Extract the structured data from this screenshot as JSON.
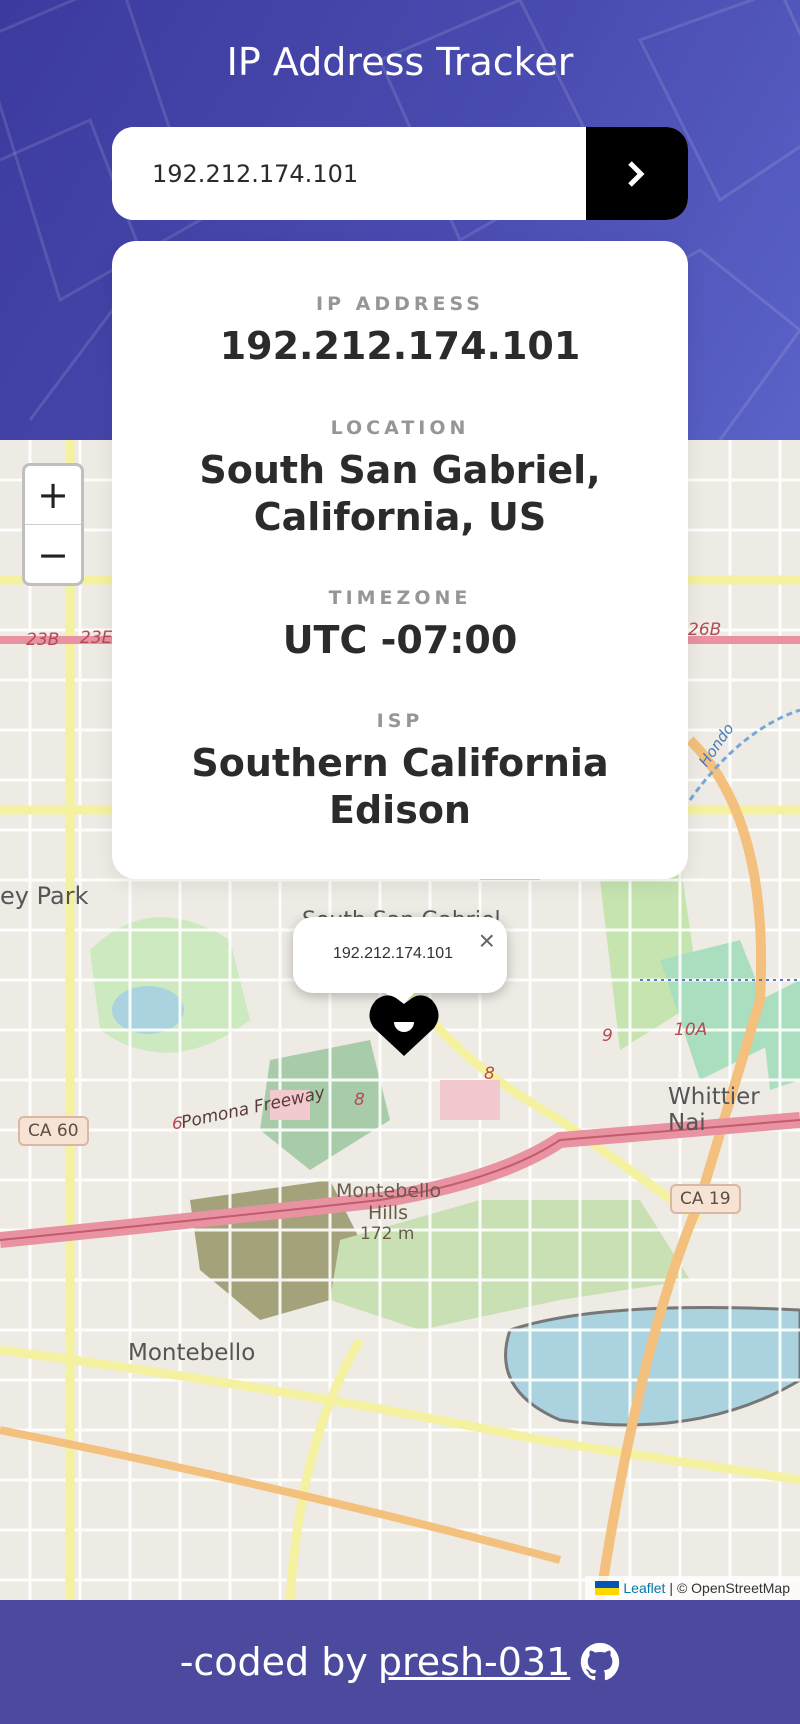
{
  "header": {
    "title": "IP Address Tracker",
    "search": {
      "value": "192.212.174.101",
      "placeholder": ""
    }
  },
  "info": {
    "ip_label": "IP ADDRESS",
    "ip_value": "192.212.174.101",
    "location_label": "LOCATION",
    "location_value": "South San Gabriel, California, US",
    "timezone_label": "TIMEZONE",
    "timezone_value": "UTC -07:00",
    "isp_label": "ISP",
    "isp_value": "Southern California Edison"
  },
  "map": {
    "zoom_in": "+",
    "zoom_out": "−",
    "popup_text": "192.212.174.101",
    "popup_close": "×",
    "labels": {
      "park": "ey Park",
      "south": "South San Gabriel",
      "whittier": "Whittier Nai",
      "montebello_hills": "Montebello",
      "hills": "Hills",
      "elevation": "172 m",
      "montebello": "Montebello",
      "freeway": "Pomona Freeway"
    },
    "shields": {
      "ca60": "CA 60",
      "ca19": "CA 19"
    },
    "road_numbers": {
      "r23b": "23B",
      "r23e": "23E",
      "r26b": "26B",
      "r10a": "10A",
      "r9": "9",
      "r8a": "8",
      "r8b": "8",
      "r6": "6",
      "hondo": "Hondo"
    }
  },
  "attribution": {
    "leaflet": "Leaflet",
    "rest": "| © OpenStreetMap"
  },
  "footer": {
    "prefix": "-coded by",
    "author": "presh-031"
  },
  "colors": {
    "header_gradient_start": "#3c3a9e",
    "footer_bg": "#4b4a9f",
    "button_bg": "#000000"
  }
}
